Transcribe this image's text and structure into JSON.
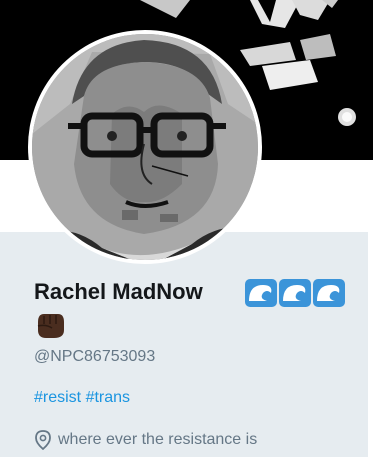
{
  "profile": {
    "display_name": "Rachel MadNow",
    "name_emojis": [
      "wave-icon",
      "wave-icon",
      "wave-icon"
    ],
    "extra_emoji": "raised-fist-icon",
    "handle": "@NPC86753093",
    "bio_hashtags": [
      "#resist",
      "#trans"
    ],
    "location": "where ever the resistance is",
    "location_icon": "location-pin-icon"
  },
  "colors": {
    "banner": "#000000",
    "card_background": "#e6ecf0",
    "name": "#14171a",
    "muted": "#657786",
    "link": "#1b95e0",
    "wave": "#3b94d9",
    "fist": "#4a2d1f"
  }
}
